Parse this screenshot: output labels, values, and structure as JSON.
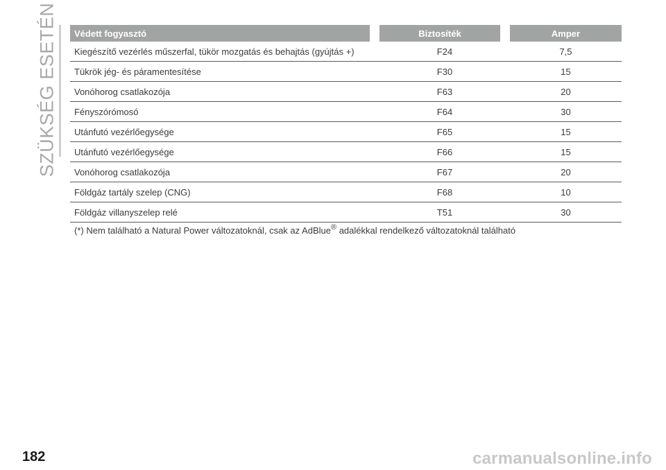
{
  "section_title": "SZÜKSÉG ESETÉN",
  "page_number": "182",
  "watermark": "carmanualsonline.info",
  "table": {
    "headers": [
      "Védett fogyasztó",
      "Biztosíték",
      "Amper"
    ],
    "rows": [
      {
        "consumer": "Kiegészítő vezérlés műszerfal, tükör mozgatás és behajtás (gyújtás +)",
        "fuse": "F24",
        "amp": "7,5"
      },
      {
        "consumer": "Tükrök jég- és páramentesítése",
        "fuse": "F30",
        "amp": "15"
      },
      {
        "consumer": "Vonóhorog csatlakozója",
        "fuse": "F63",
        "amp": "20"
      },
      {
        "consumer": "Fényszórómosó",
        "fuse": "F64",
        "amp": "30"
      },
      {
        "consumer": "Utánfutó vezérlőegysége",
        "fuse": "F65",
        "amp": "15"
      },
      {
        "consumer": "Utánfutó vezérlőegysége",
        "fuse": "F66",
        "amp": "15"
      },
      {
        "consumer": "Vonóhorog csatlakozója",
        "fuse": "F67",
        "amp": "20"
      },
      {
        "consumer": "Földgáz tartály szelep (CNG)",
        "fuse": "F68",
        "amp": "10"
      },
      {
        "consumer": "Földgáz villanyszelep relé",
        "fuse": "T51",
        "amp": "30"
      }
    ]
  },
  "footnote": {
    "before": "(*) Nem található a Natural Power változatoknál, csak az AdBlue",
    "mark": "®",
    "after": " adalékkal rendelkező változatoknál található"
  },
  "colors": {
    "header_bg": "#a2a3a3",
    "text": "#3a3a3a",
    "side_title": "#a8a8a8"
  }
}
